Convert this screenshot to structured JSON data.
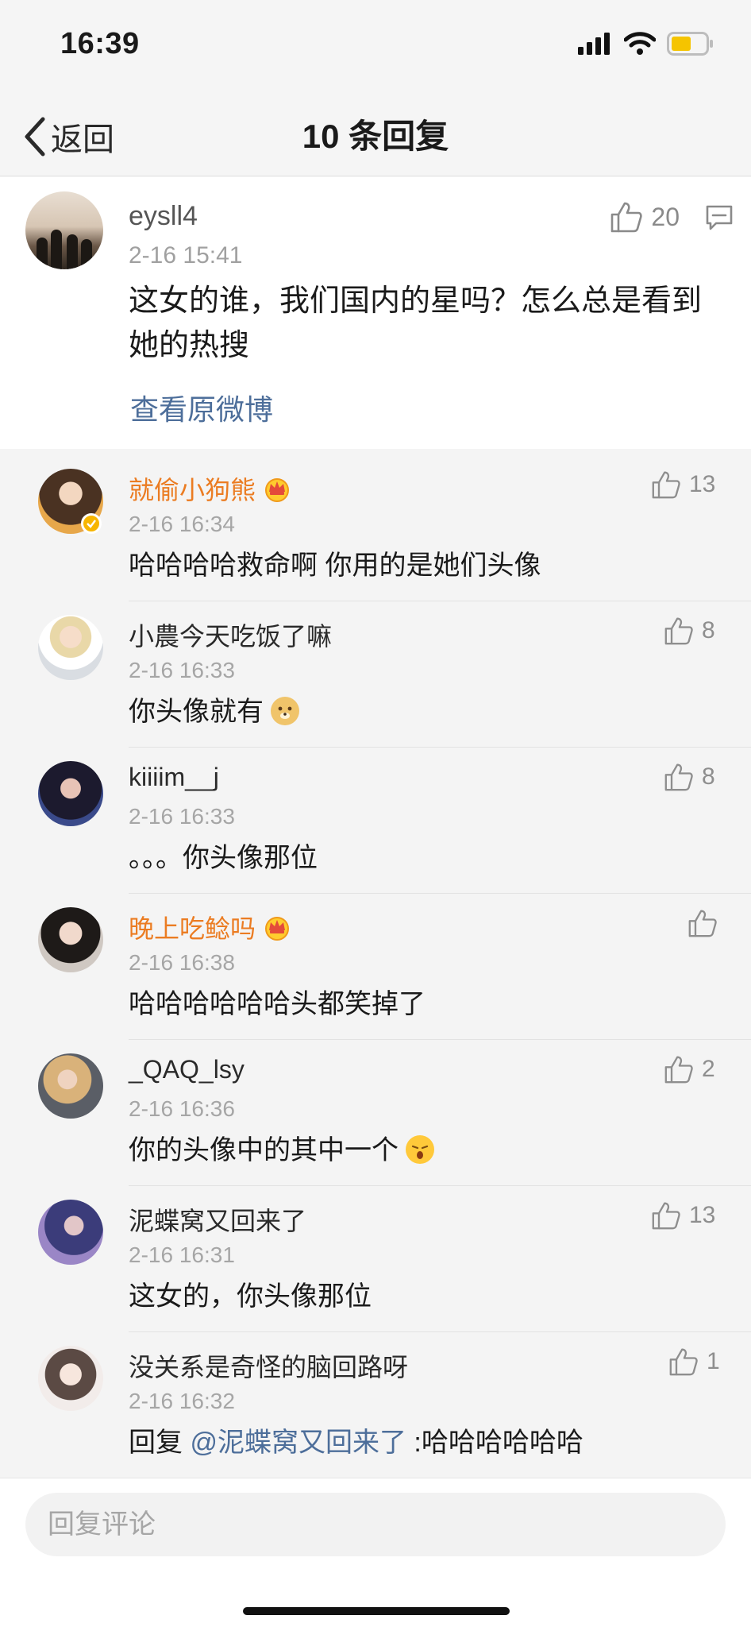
{
  "status_bar": {
    "time": "16:39",
    "icons": [
      "signal-icon",
      "wifi-icon",
      "battery-low-icon"
    ]
  },
  "nav": {
    "back_label": "返回",
    "title": "10 条回复"
  },
  "main_post": {
    "username": "eysll4",
    "time": "2-16 15:41",
    "text": "这女的谁，我们国内的星吗？怎么总是看到她的热搜",
    "like_count": "20",
    "view_original": "查看原微博"
  },
  "replies": [
    {
      "username": "就偷小狗熊",
      "vip": true,
      "time": "2-16 16:34",
      "text": "哈哈哈哈救命啊 你用的是她们头像",
      "likes": "13"
    },
    {
      "username": "小農今天吃饭了嘛",
      "vip": false,
      "time": "2-16 16:33",
      "text": "你头像就有",
      "emoji": "doge-emoji",
      "likes": "8"
    },
    {
      "username": "kiiiim__j",
      "vip": false,
      "time": "2-16 16:33",
      "text": "。。。你头像那位",
      "likes": "8"
    },
    {
      "username": "晚上吃鲶吗",
      "vip": true,
      "time": "2-16 16:38",
      "text": "哈哈哈哈哈哈头都笑掉了",
      "likes": ""
    },
    {
      "username": "_QAQ_lsy",
      "vip": false,
      "time": "2-16 16:36",
      "text": "你的头像中的其中一个",
      "emoji": "shocked-emoji",
      "likes": "2"
    },
    {
      "username": "泥蝶窝又回来了",
      "vip": false,
      "time": "2-16 16:31",
      "text": "这女的，你头像那位",
      "likes": "13"
    },
    {
      "username": "没关系是奇怪的脑回路呀",
      "vip": false,
      "time": "2-16 16:32",
      "text_prefix": "回复",
      "mention": "@泥蝶窝又回来了",
      "text": ":哈哈哈哈哈哈",
      "likes": "1"
    }
  ],
  "bottom_bar": {
    "placeholder": "回复评论"
  },
  "colors": {
    "vip_name": "#eb7c22",
    "link": "#4d6e9a",
    "time": "#a6a6a6",
    "battery": "#f5c400"
  }
}
